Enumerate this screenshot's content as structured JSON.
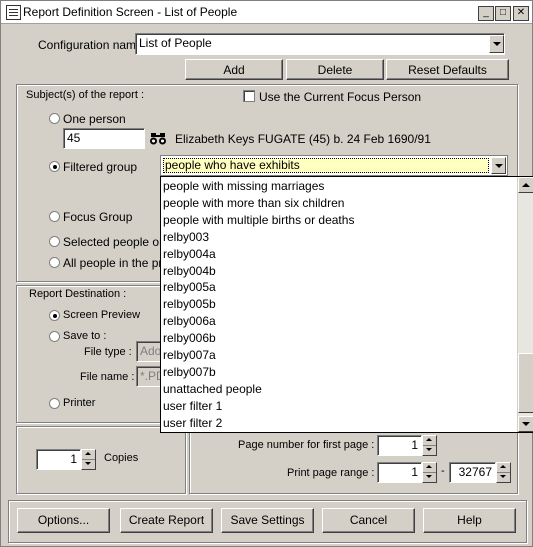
{
  "window": {
    "title": "Report Definition Screen - List of People"
  },
  "config": {
    "label": "Configuration name",
    "value": "List of People",
    "add_label": "Add",
    "delete_label": "Delete",
    "reset_label": "Reset Defaults"
  },
  "subjects": {
    "heading": "Subject(s) of the report :",
    "use_focus_label": "Use the Current Focus Person",
    "one_person_label": "One person",
    "person_id": "45",
    "person_desc": "Elizabeth Keys FUGATE (45) b. 24 Feb 1690/91",
    "filtered_group_label": "Filtered group",
    "filter_value": "people who have exhibits",
    "focus_group_label": "Focus Group",
    "selected_people_label": "Selected people on t",
    "all_people_label": "All people in the pro"
  },
  "filter_options": [
    "people with missing marriages",
    "people with more than six children",
    "people with multiple births or deaths",
    "relby003",
    "relby004a",
    "relby004b",
    "relby005a",
    "relby005b",
    "relby006a",
    "relby006b",
    "relby007a",
    "relby007b",
    "unattached people",
    "user filter 1",
    "user filter 2"
  ],
  "destination": {
    "heading": "Report Destination :",
    "screen_preview_label": "Screen Preview",
    "save_to_label": "Save to :",
    "file_type_label": "File type :",
    "file_type_value": "Ado",
    "file_name_label": "File name :",
    "file_name_value": "*.PD",
    "printer_label": "Printer"
  },
  "copies": {
    "value": "1",
    "label": "Copies"
  },
  "pages": {
    "first_page_label": "Page number for first page :",
    "first_page_value": "1",
    "range_label": "Print page range :",
    "range_from": "1",
    "range_sep": "-",
    "range_to": "32767"
  },
  "buttons": {
    "options": "Options...",
    "create": "Create Report",
    "save": "Save Settings",
    "cancel": "Cancel",
    "help": "Help"
  },
  "icons": {
    "binoculars": "binoculars-icon"
  }
}
